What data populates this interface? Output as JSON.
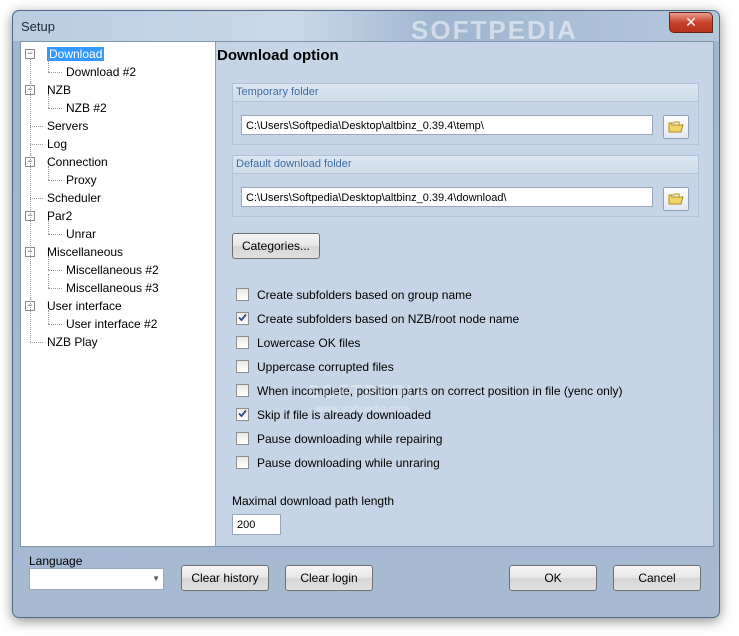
{
  "window": {
    "title": "Setup",
    "close_symbol": "✕"
  },
  "tree": {
    "items": [
      {
        "label": "Download",
        "level": 0,
        "expander": "−",
        "selected": true
      },
      {
        "label": "Download #2",
        "level": 1
      },
      {
        "label": "NZB",
        "level": 0,
        "expander": "−"
      },
      {
        "label": "NZB #2",
        "level": 1
      },
      {
        "label": "Servers",
        "level": 0
      },
      {
        "label": "Log",
        "level": 0
      },
      {
        "label": "Connection",
        "level": 0,
        "expander": "−"
      },
      {
        "label": "Proxy",
        "level": 1
      },
      {
        "label": "Scheduler",
        "level": 0
      },
      {
        "label": "Par2",
        "level": 0,
        "expander": "−"
      },
      {
        "label": "Unrar",
        "level": 1
      },
      {
        "label": "Miscellaneous",
        "level": 0,
        "expander": "−"
      },
      {
        "label": "Miscellaneous #2",
        "level": 1
      },
      {
        "label": "Miscellaneous #3",
        "level": 1
      },
      {
        "label": "User interface",
        "level": 0,
        "expander": "−"
      },
      {
        "label": "User interface #2",
        "level": 1
      },
      {
        "label": "NZB Play",
        "level": 0
      }
    ]
  },
  "panel": {
    "title": "Download option",
    "temp_folder": {
      "label": "Temporary folder",
      "value": "C:\\Users\\Softpedia\\Desktop\\altbinz_0.39.4\\temp\\"
    },
    "download_folder": {
      "label": "Default download folder",
      "value": "C:\\Users\\Softpedia\\Desktop\\altbinz_0.39.4\\download\\"
    },
    "categories_button": "Categories...",
    "options": [
      {
        "label": "Create subfolders based on group name",
        "checked": false
      },
      {
        "label": "Create subfolders based on NZB/root node name",
        "checked": true
      },
      {
        "label": "Lowercase OK files",
        "checked": false
      },
      {
        "label": "Uppercase corrupted files",
        "checked": false
      },
      {
        "label": "When incomplete, position parts on correct position in file (yenc only)",
        "checked": false
      },
      {
        "label": "Skip if file is already downloaded",
        "checked": true
      },
      {
        "label": "Pause downloading while repairing",
        "checked": false
      },
      {
        "label": "Pause downloading while unraring",
        "checked": false
      }
    ],
    "max_path": {
      "label": "Maximal download path length",
      "value": "200"
    }
  },
  "footer": {
    "language_label": "Language",
    "language_value": "",
    "clear_history": "Clear history",
    "clear_login": "Clear login",
    "ok": "OK",
    "cancel": "Cancel"
  },
  "watermark": {
    "title": "SOFTPEDIA",
    "center": "SOFTPEDIA",
    "url": "www.softpedia.com"
  },
  "colors": {
    "selection": "#3399ff",
    "check": "#21a121",
    "panel": "#c5d4e6"
  }
}
